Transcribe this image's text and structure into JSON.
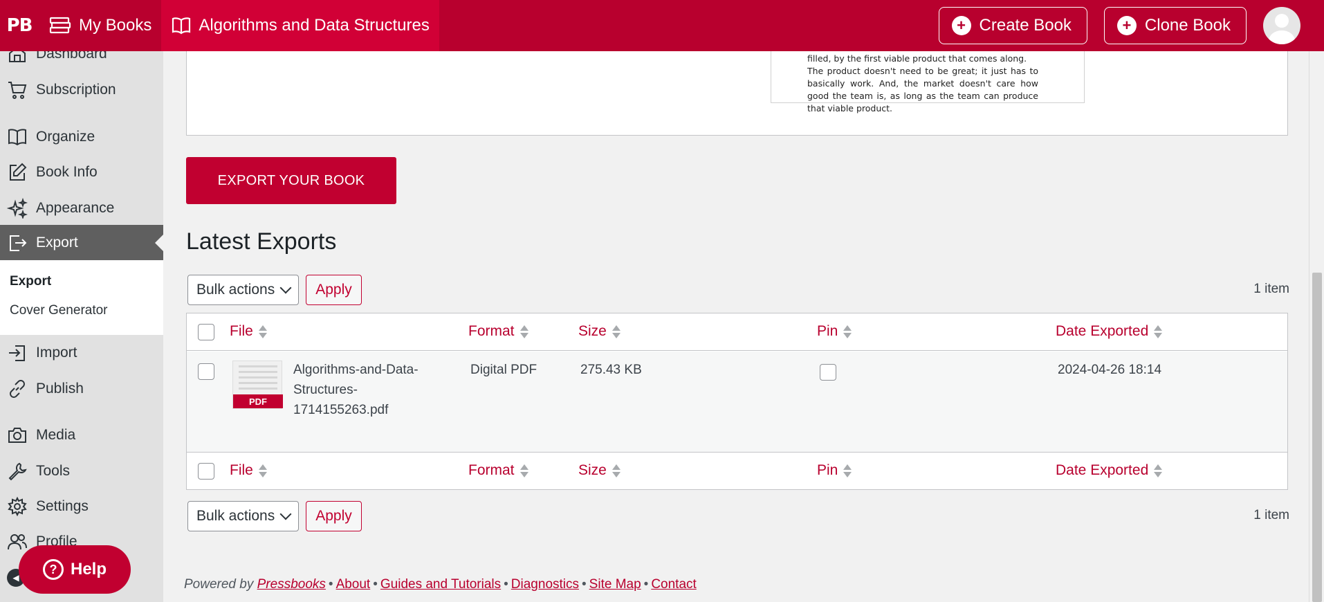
{
  "topbar": {
    "logo": "PB",
    "my_books": "My Books",
    "book_title": "Algorithms and Data Structures",
    "create_book": "Create Book",
    "clone_book": "Clone Book",
    "brand_color": "#b8002e"
  },
  "sidebar": {
    "items": [
      {
        "label": "Dashboard",
        "icon": "home-icon"
      },
      {
        "label": "Subscription",
        "icon": "cart-icon"
      },
      {
        "label": "Organize",
        "icon": "book-open-icon"
      },
      {
        "label": "Book Info",
        "icon": "edit-icon"
      },
      {
        "label": "Appearance",
        "icon": "sparkles-icon"
      },
      {
        "label": "Export",
        "icon": "export-icon"
      },
      {
        "label": "Import",
        "icon": "import-icon"
      },
      {
        "label": "Publish",
        "icon": "link-icon"
      },
      {
        "label": "Media",
        "icon": "camera-icon"
      },
      {
        "label": "Tools",
        "icon": "wrench-icon"
      },
      {
        "label": "Settings",
        "icon": "gear-icon"
      },
      {
        "label": "Profile",
        "icon": "users-icon"
      }
    ],
    "submenu": [
      "Export",
      "Cover Generator"
    ],
    "help": "Help"
  },
  "preview": {
    "line1": "filled, by the first viable product that comes along.",
    "line2": "The product doesn't need to be great; it just has to basically work. And, the market doesn't care how good the team is, as long as the team can produce that viable product."
  },
  "export_button": "EXPORT YOUR BOOK",
  "latest_exports": {
    "title": "Latest Exports",
    "bulk_actions": "Bulk actions",
    "apply": "Apply",
    "count": "1 item",
    "columns": [
      "File",
      "Format",
      "Size",
      "Pin",
      "Date Exported"
    ],
    "rows": [
      {
        "file": "Algorithms-and-Data-Structures-1714155263.pdf",
        "file_lines": [
          "Algorithms-and-Data-",
          "Structures-",
          "1714155263.pdf"
        ],
        "thumb_label": "PDF",
        "format": "Digital PDF",
        "size": "275.43 KB",
        "pinned": false,
        "date": "2024-04-26 18:14"
      }
    ]
  },
  "footer": {
    "powered_by": "Powered by",
    "links": [
      "Pressbooks",
      "About",
      "Guides and Tutorials",
      "Diagnostics",
      "Site Map",
      "Contact"
    ]
  }
}
